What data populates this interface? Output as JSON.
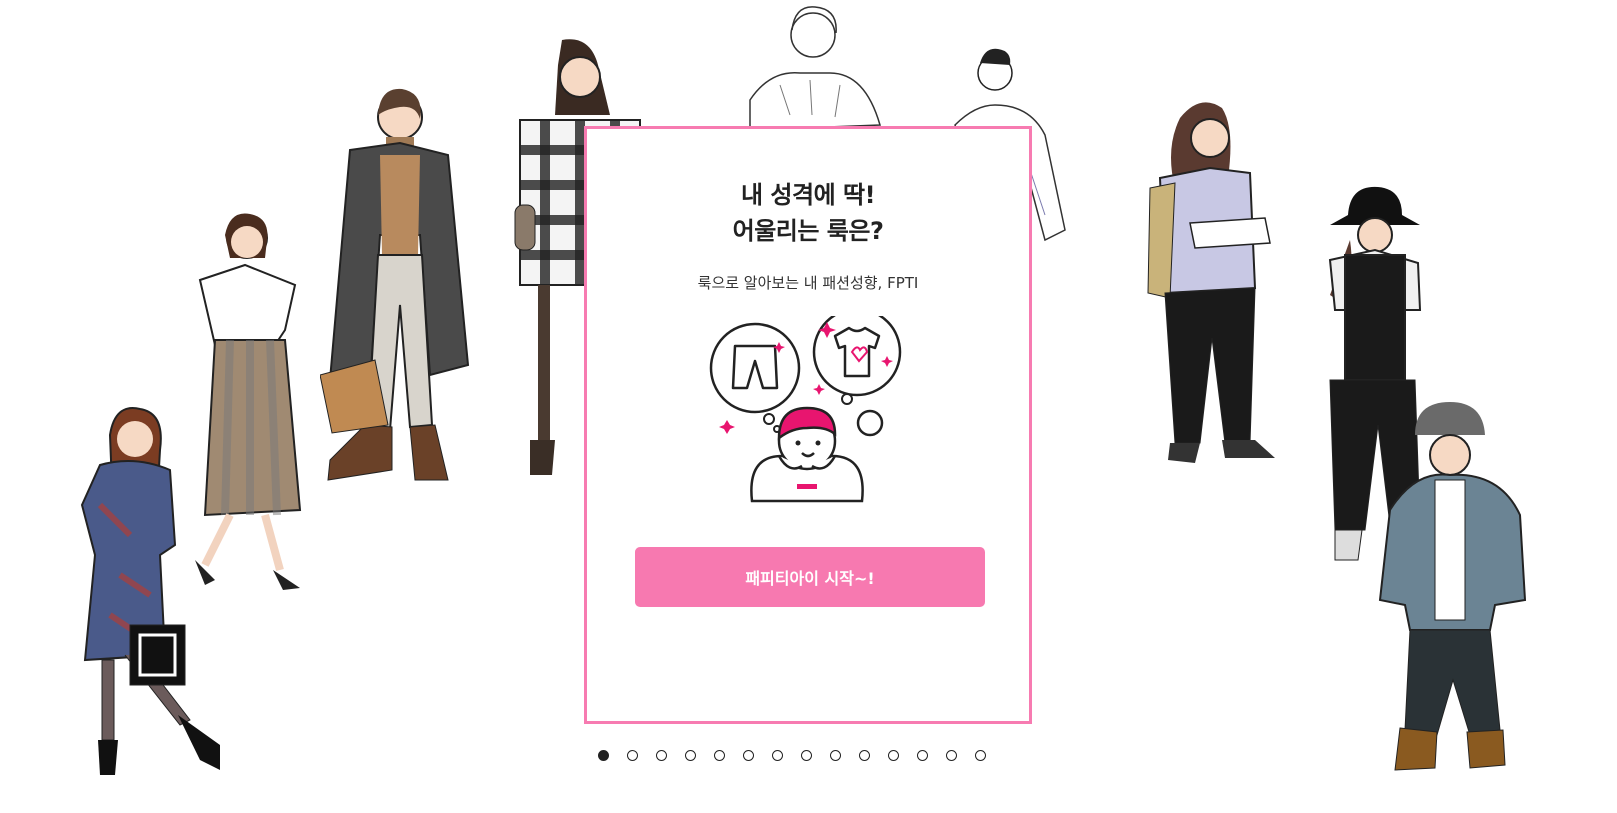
{
  "card": {
    "title_line1": "내 성격에 딱!",
    "title_line2": "어울리는 룩은?",
    "subtitle": "룩으로 알아보는 내 패션성향, FPTI",
    "illustration_icon": "thinking-person-clothes-icon",
    "start_button_label": "패피티아이 시작~!"
  },
  "colors": {
    "accent": "#f77bb1",
    "button": "#f779b0",
    "text": "#222222"
  },
  "pagination": {
    "total": 14,
    "active_index": 0
  }
}
